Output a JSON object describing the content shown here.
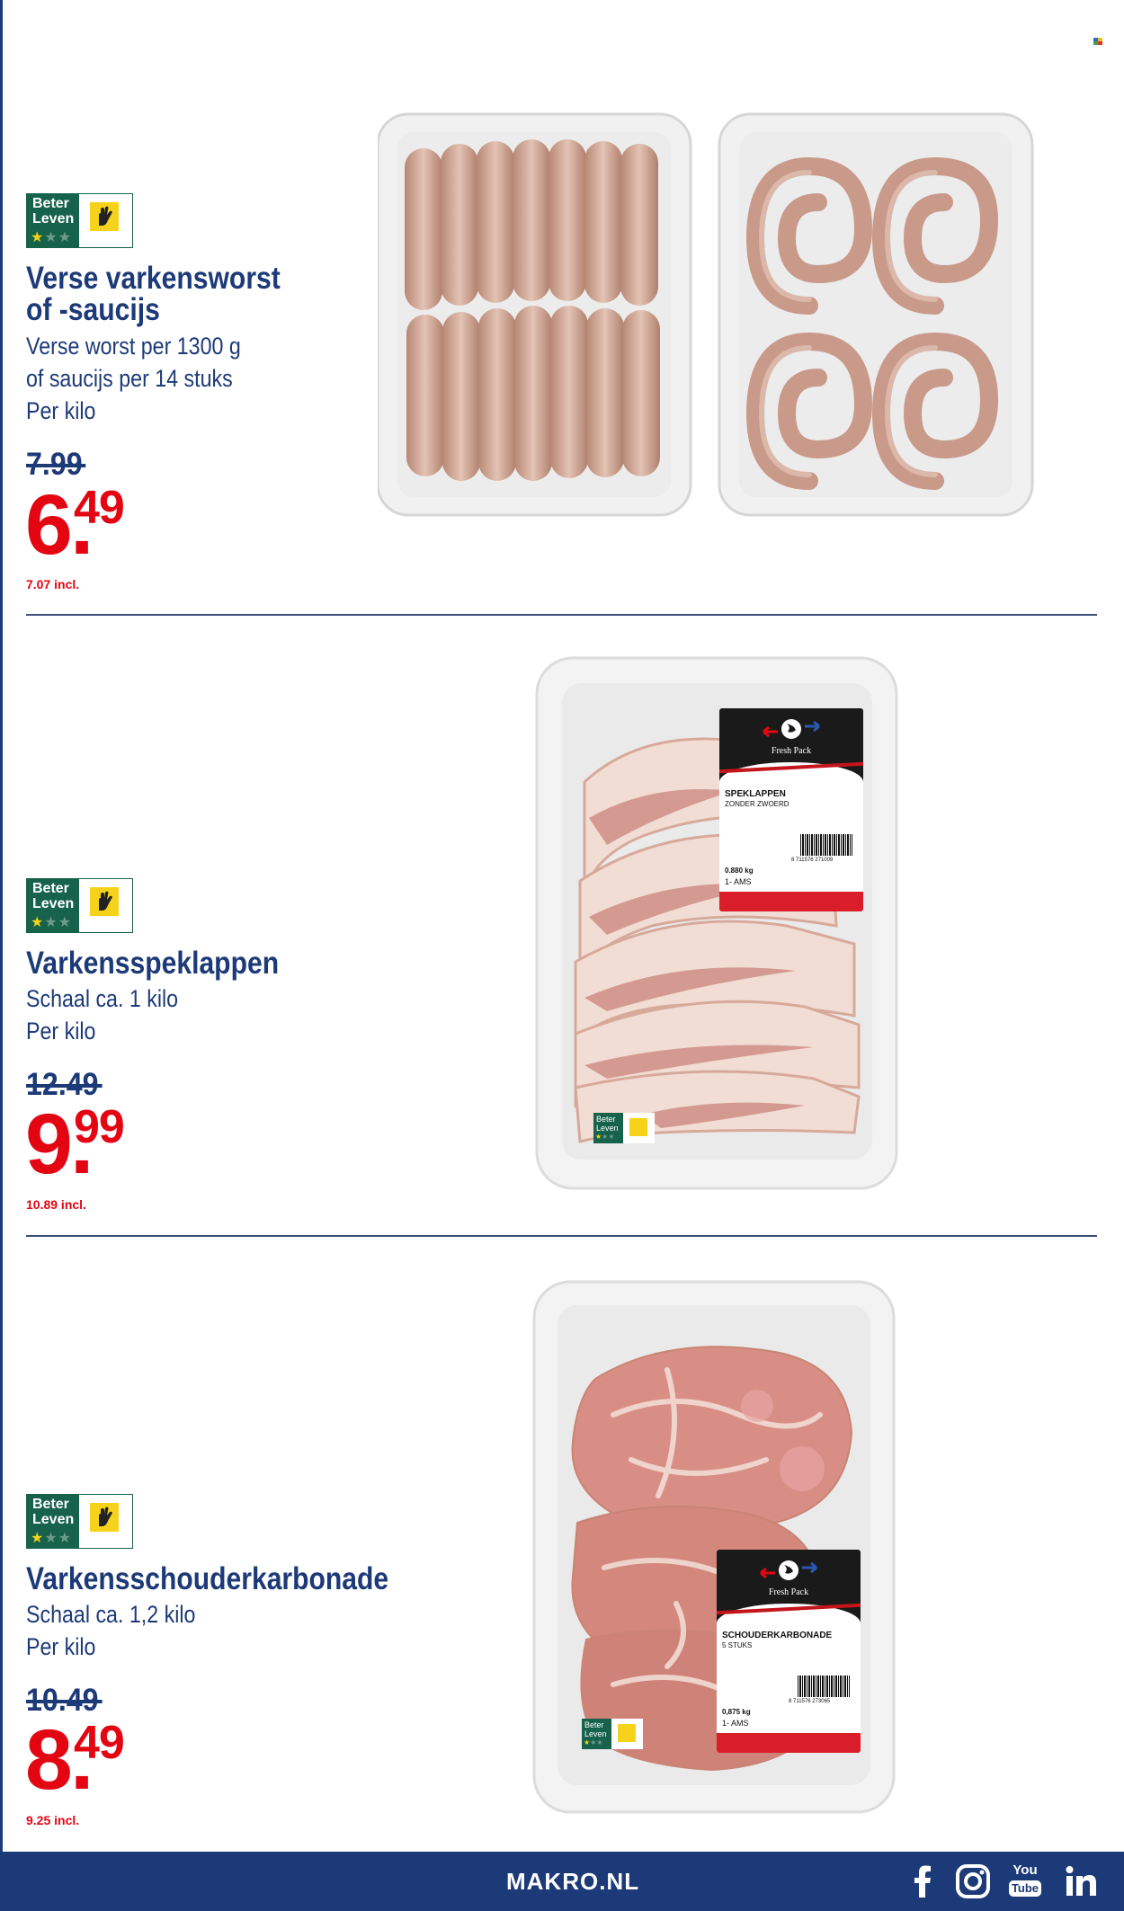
{
  "products": [
    {
      "logo": {
        "word1": "Beter",
        "word2": "Leven",
        "stars_label": "★★★",
        "icon": "hand-icon"
      },
      "title_lines": [
        "Verse varkensworst",
        "of -saucijs"
      ],
      "details": [
        "Verse worst per 1300 g",
        "of saucijs per 14 stuks",
        "Per kilo"
      ],
      "old_price": "7.99",
      "price_main": "6",
      "price_cents": "49",
      "price_incl": "7.07 incl."
    },
    {
      "logo": {
        "word1": "Beter",
        "word2": "Leven",
        "stars_label": "★★★",
        "icon": "hand-icon"
      },
      "title_lines": [
        "Varkensspeklappen"
      ],
      "details": [
        "Schaal ca. 1 kilo",
        "Per kilo"
      ],
      "old_price": "12.49",
      "price_main": "9",
      "price_cents": "99",
      "price_incl": "10.89 incl.",
      "package_label": {
        "brand": "Fresh Pack",
        "product": "SPEKLAPPEN",
        "sub": "ZONDER ZWOERD",
        "weight": "0.880 kg",
        "store": "1- AMS",
        "barcode": "8 711576 271009"
      },
      "mini_logo": {
        "word1": "Beter",
        "word2": "Leven"
      }
    },
    {
      "logo": {
        "word1": "Beter",
        "word2": "Leven",
        "stars_label": "★★★",
        "icon": "hand-icon"
      },
      "title_lines": [
        "Varkensschouderkarbonade"
      ],
      "details": [
        "Schaal ca. 1,2 kilo",
        "Per kilo"
      ],
      "old_price": "10.49",
      "price_main": "8",
      "price_cents": "49",
      "price_incl": "9.25 incl.",
      "package_label": {
        "brand": "Fresh Pack",
        "product": "SCHOUDERKARBONADE",
        "sub": "5 STUKS",
        "weight": "0,875 kg",
        "store": "1- AMS",
        "barcode": "8 711576 273065"
      },
      "mini_logo": {
        "word1": "Beter",
        "word2": "Leven"
      }
    }
  ],
  "footer": {
    "site": "MAKRO.NL",
    "social_icons": [
      "facebook-icon",
      "instagram-icon",
      "youtube-icon",
      "linkedin-icon"
    ],
    "youtube_text_1": "You",
    "youtube_text_2": "Tube"
  },
  "colors": {
    "brand_blue": "#1d3a78",
    "price_red": "#e40513",
    "beter_leven_green": "#17624a"
  }
}
